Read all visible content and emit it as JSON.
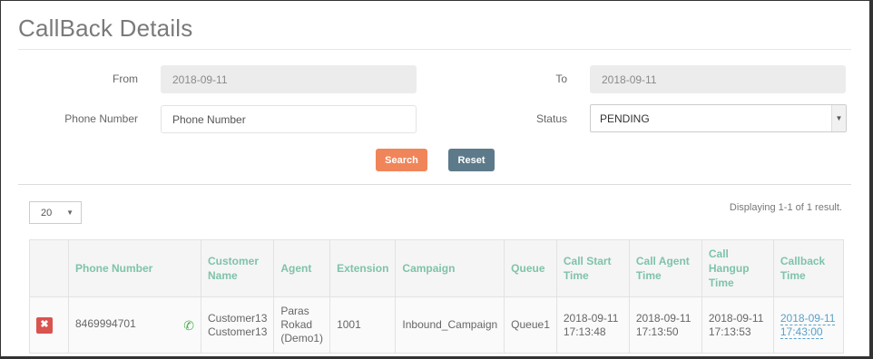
{
  "page": {
    "title": "CallBack Details"
  },
  "filters": {
    "from_label": "From",
    "from_value": "2018-09-11",
    "to_label": "To",
    "to_value": "2018-09-11",
    "phone_label": "Phone Number",
    "phone_placeholder": "Phone Number",
    "status_label": "Status",
    "status_value": "PENDING"
  },
  "actions": {
    "search_label": "Search",
    "reset_label": "Reset"
  },
  "list": {
    "page_size": "20",
    "summary": "Displaying 1-1 of 1 result."
  },
  "table": {
    "headers": [
      "",
      "Phone Number",
      "Customer Name",
      "Agent",
      "Extension",
      "Campaign",
      "Queue",
      "Call Start Time",
      "Call Agent Time",
      "Call Hangup Time",
      "Callback Time"
    ],
    "rows": [
      {
        "phone": "8469994701",
        "customer": "Customer13 Customer13",
        "agent": "Paras Rokad (Demo1)",
        "extension": "1001",
        "campaign": "Inbound_Campaign",
        "queue": "Queue1",
        "call_start": "2018-09-11 17:13:48",
        "call_agent": "2018-09-11 17:13:50",
        "call_hangup": "2018-09-11 17:13:53",
        "callback": "2018-09-11 17:43:00"
      }
    ]
  },
  "colors": {
    "accent_green": "#7fc3a9",
    "search_orange": "#f0855a",
    "reset_slate": "#5d7a8a",
    "delete_red": "#d9534f"
  },
  "icons": {
    "delete": "close-icon",
    "phone": "phone-icon",
    "dropdown": "caret-down-icon"
  }
}
